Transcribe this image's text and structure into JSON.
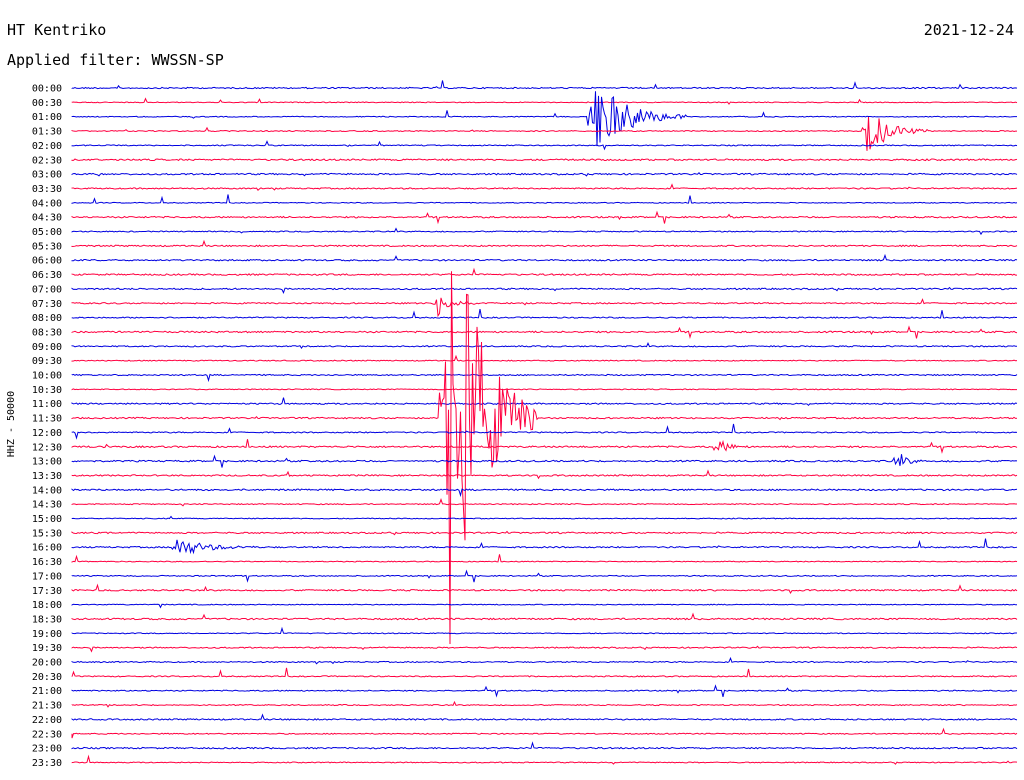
{
  "header": {
    "station": "HT Kentriko",
    "date": "2021-12-24",
    "filter": "Applied filter: WWSSN-SP"
  },
  "colors": {
    "even_trace": "#0000e0",
    "odd_trace": "#ff0040",
    "background": "#ffffff",
    "text": "#000000"
  },
  "chart_data": {
    "type": "line",
    "title": "",
    "xlabel": "",
    "ylabel": "HHZ - 50000",
    "grid": false,
    "legend": "none",
    "tick_labels": [
      "00:00",
      "00:30",
      "01:00",
      "01:30",
      "02:00",
      "02:30",
      "03:00",
      "03:30",
      "04:00",
      "04:30",
      "05:00",
      "05:30",
      "06:00",
      "06:30",
      "07:00",
      "07:30",
      "08:00",
      "08:30",
      "09:00",
      "09:30",
      "10:00",
      "10:30",
      "11:00",
      "11:30",
      "12:00",
      "12:30",
      "13:00",
      "13:30",
      "14:00",
      "14:30",
      "15:00",
      "15:30",
      "16:00",
      "16:30",
      "17:00",
      "17:30",
      "18:00",
      "18:30",
      "19:00",
      "19:30",
      "20:00",
      "20:30",
      "21:00",
      "21:30",
      "22:00",
      "22:30",
      "23:00",
      "23:30"
    ],
    "x_range_minutes": [
      0,
      30
    ],
    "events": [
      {
        "row": 2,
        "minute": 16.5,
        "amplitude": 44,
        "duration_min": 3
      },
      {
        "row": 3,
        "minute": 25.2,
        "amplitude": 26,
        "duration_min": 2
      },
      {
        "row": 23,
        "minute": 11.8,
        "amplitude": 300,
        "duration_min": 3
      },
      {
        "row": 15,
        "minute": 11.6,
        "amplitude": 14,
        "duration_min": 1.2
      },
      {
        "row": 25,
        "minute": 20.5,
        "amplitude": 8,
        "duration_min": 1
      },
      {
        "row": 26,
        "minute": 26.2,
        "amplitude": 10,
        "duration_min": 0.8
      },
      {
        "row": 32,
        "minute": 3.3,
        "amplitude": 10,
        "duration_min": 2.5
      },
      {
        "row": 5,
        "minute": 0,
        "amplitude": 0,
        "duration_min": 0
      }
    ]
  }
}
